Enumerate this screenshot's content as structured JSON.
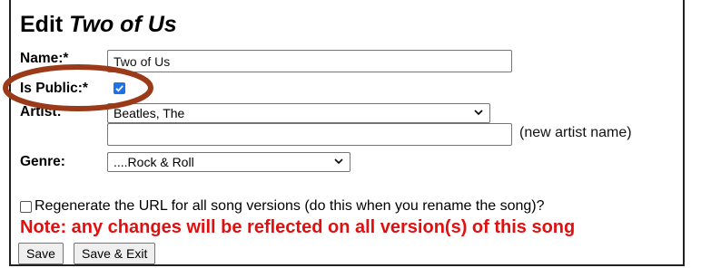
{
  "heading": {
    "prefix": "Edit",
    "song_title": "Two of Us"
  },
  "form": {
    "name": {
      "label": "Name:*",
      "value": "Two of Us"
    },
    "is_public": {
      "label": "Is Public:*",
      "checked": true
    },
    "artist": {
      "label": "Artist:",
      "selected": "Beatles, The",
      "new_artist_value": "",
      "new_artist_hint": "(new artist name)"
    },
    "genre": {
      "label": "Genre:",
      "selected": "....Rock & Roll"
    },
    "regenerate": {
      "label": "Regenerate the URL for all song versions (do this when you rename the song)?",
      "checked": false
    },
    "note": "Note: any changes will be reflected on all version(s) of this song"
  },
  "buttons": {
    "save": "Save",
    "save_exit": "Save & Exit"
  },
  "colors": {
    "note": "#e01010",
    "annotation_circle": "#9a3a18",
    "checkbox_accent": "#1a73e8"
  }
}
